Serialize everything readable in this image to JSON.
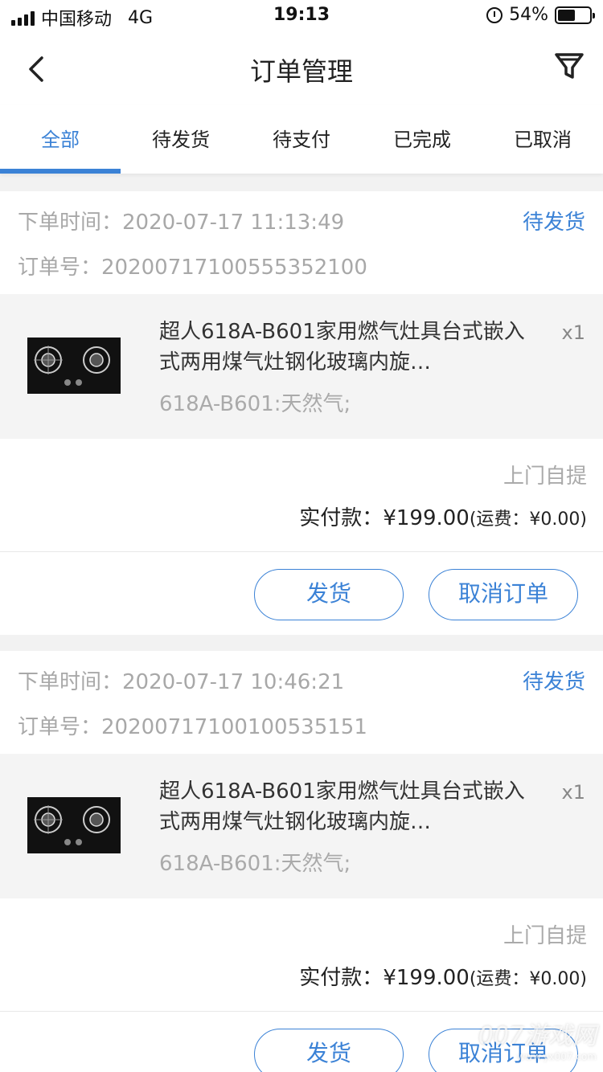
{
  "status_bar": {
    "carrier": "中国移动",
    "network": "4G",
    "time": "19:13",
    "battery": "54%",
    "battery_level": 0.54
  },
  "nav": {
    "title": "订单管理",
    "back_icon": "chevron-left-icon",
    "filter_icon": "funnel-icon"
  },
  "tabs": [
    {
      "label": "全部",
      "active": true
    },
    {
      "label": "待发货",
      "active": false
    },
    {
      "label": "待支付",
      "active": false
    },
    {
      "label": "已完成",
      "active": false
    },
    {
      "label": "已取消",
      "active": false
    }
  ],
  "accent_color": "#3b82d6",
  "orders": [
    {
      "time_label": "下单时间：",
      "time": "2020-07-17 11:13:49",
      "status": "待发货",
      "no_label": "订单号：",
      "order_no": "20200717100555352100",
      "product_name": "超人618A-B601家用燃气灶具台式嵌入式两用煤气灶钢化玻璃内旋…",
      "qty": "x1",
      "spec": "618A-B601:天然气;",
      "delivery": "上门自提",
      "paid_label": "实付款：",
      "paid_amount": "¥199.00",
      "fee_text": "(运费：¥0.00)",
      "ship_button": "发货",
      "cancel_button": "取消订单"
    },
    {
      "time_label": "下单时间：",
      "time": "2020-07-17 10:46:21",
      "status": "待发货",
      "no_label": "订单号：",
      "order_no": "20200717100100535151",
      "product_name": "超人618A-B601家用燃气灶具台式嵌入式两用煤气灶钢化玻璃内旋…",
      "qty": "x1",
      "spec": "618A-B601:天然气;",
      "delivery": "上门自提",
      "paid_label": "实付款：",
      "paid_amount": "¥199.00",
      "fee_text": "(运费：¥0.00)",
      "ship_button": "发货",
      "cancel_button": "取消订单"
    }
  ],
  "watermark": {
    "text": "007游戏网",
    "url": "www.yx007.com"
  }
}
